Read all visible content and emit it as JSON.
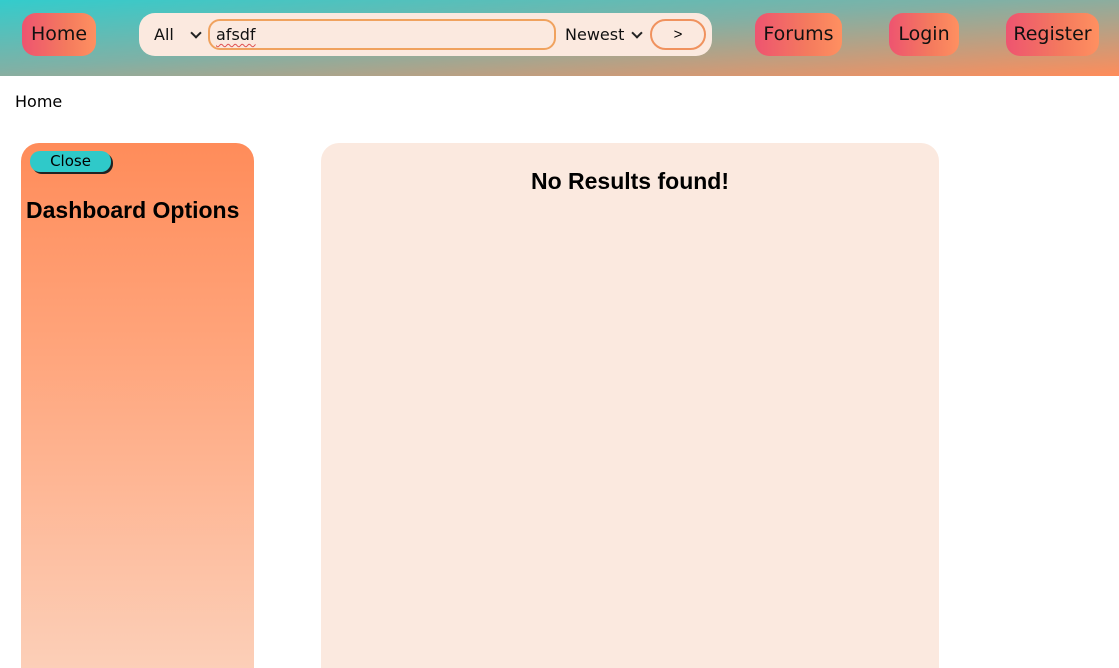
{
  "nav": {
    "home_label": "Home",
    "forums_label": "Forums",
    "login_label": "Login",
    "register_label": "Register"
  },
  "search": {
    "category_value": "All",
    "query_value": "afsdf",
    "sort_value": "Newest",
    "submit_label": ">"
  },
  "breadcrumb": {
    "current": "Home"
  },
  "sidebar": {
    "close_label": "Close",
    "title": "Dashboard Options"
  },
  "main": {
    "message": "No Results found!"
  },
  "colors": {
    "accent_teal": "#33cccc",
    "accent_coral": "#ff8c5a",
    "button_pink": "#ee5470",
    "panel_bg": "#fbe9df"
  }
}
